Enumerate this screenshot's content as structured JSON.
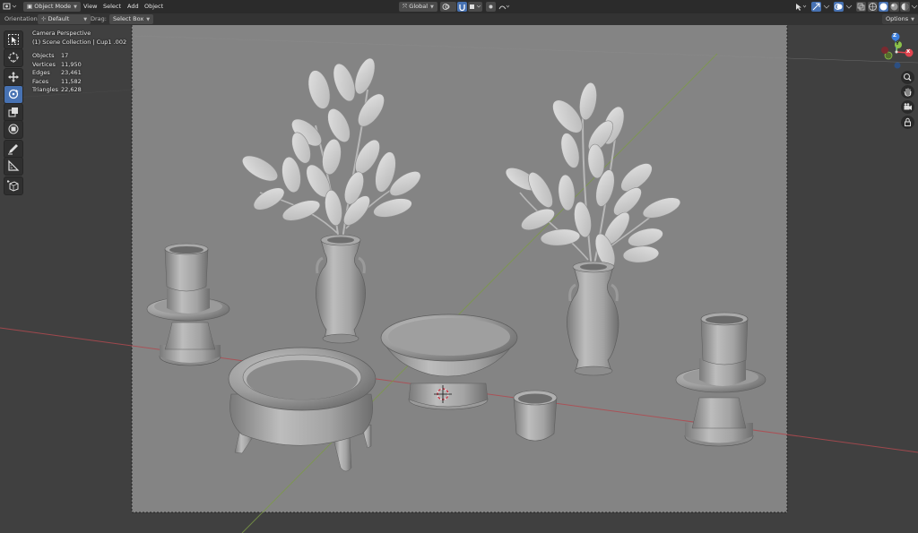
{
  "header": {
    "mode_label": "Object Mode",
    "menu": [
      "View",
      "Select",
      "Add",
      "Object"
    ],
    "transform_orientation": "Global",
    "options_label": "Options"
  },
  "tool_settings": {
    "orientation_label": "Orientation:",
    "orientation_value": "Default",
    "drag_label": "Drag:",
    "drag_value": "Select Box"
  },
  "overlay": {
    "view_name": "Camera Perspective",
    "collection": "(1) Scene Collection | Cup1 .002",
    "stats": [
      {
        "label": "Objects",
        "value": "17"
      },
      {
        "label": "Vertices",
        "value": "11,950"
      },
      {
        "label": "Edges",
        "value": "23,461"
      },
      {
        "label": "Faces",
        "value": "11,582"
      },
      {
        "label": "Triangles",
        "value": "22,628"
      }
    ]
  },
  "gizmo": {
    "x": "X",
    "y": "Y",
    "z": "Z"
  },
  "colors": {
    "accent": "#4772b3",
    "x_axis": "#e2444f",
    "y_axis": "#8bc34a",
    "z_axis": "#3d7fdc",
    "viewport_bg": "#404040",
    "camera_frame": "#848484"
  },
  "icons": [
    "editor-type-icon",
    "object-mode-icon",
    "global-orientation-icon",
    "snap-icon",
    "proportional-edit-icon",
    "select-box-tool-icon",
    "cursor-tool-icon",
    "move-tool-icon",
    "rotate-tool-icon",
    "scale-tool-icon",
    "transform-tool-icon",
    "annotate-tool-icon",
    "measure-tool-icon",
    "add-cube-tool-icon",
    "zoom-icon",
    "hand-pan-icon",
    "camera-view-icon",
    "lock-icon"
  ]
}
